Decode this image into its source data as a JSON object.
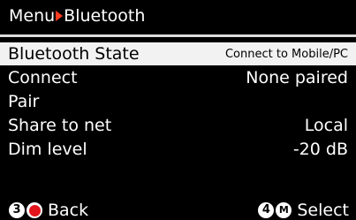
{
  "header": {
    "menu": "Menu",
    "section": "Bluetooth"
  },
  "menu_items": [
    {
      "label": "Bluetooth State",
      "value": "Connect to Mobile/PC",
      "selected": true
    },
    {
      "label": "Connect",
      "value": "None paired"
    },
    {
      "label": "Pair",
      "value": ""
    },
    {
      "label": "Share to net",
      "value": "Local"
    },
    {
      "label": "Dim level",
      "value": "-20 dB"
    }
  ],
  "footer": {
    "back_key": "3",
    "back_label": "Back",
    "select_key": "4",
    "select_key2": "M",
    "select_label": "Select"
  },
  "colors": {
    "accent": "#ff3b1f",
    "record": "#e3141b",
    "selection_bg": "#f2f2f2"
  },
  "icons": [
    "breadcrumb-arrow-icon",
    "record-dot-icon",
    "m-key-icon"
  ]
}
